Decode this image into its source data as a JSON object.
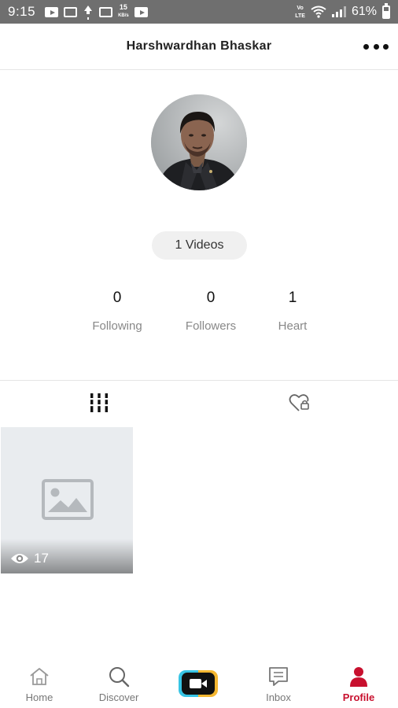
{
  "status_bar": {
    "time": "9:15",
    "data_speed_value": "15",
    "data_speed_unit": "KB/s",
    "network_label": "LTE",
    "network_sub": "Vo",
    "battery_percent": "61%"
  },
  "header": {
    "title": "Harshwardhan Bhaskar"
  },
  "profile": {
    "videos_label": "1 Videos",
    "stats": [
      {
        "value": "0",
        "label": "Following"
      },
      {
        "value": "0",
        "label": "Followers"
      },
      {
        "value": "1",
        "label": "Heart"
      }
    ]
  },
  "videos": [
    {
      "views": "17"
    }
  ],
  "bottom_nav": {
    "items": [
      {
        "label": "Home",
        "icon": "home-icon"
      },
      {
        "label": "Discover",
        "icon": "search-icon"
      },
      {
        "label": "Inbox",
        "icon": "inbox-icon"
      },
      {
        "label": "Profile",
        "icon": "person-icon"
      }
    ],
    "active": "Profile"
  },
  "colors": {
    "accent": "#c8102e",
    "status_bar": "#6f6f6f",
    "record_left": "#37c4e4",
    "record_right": "#f5b731"
  }
}
